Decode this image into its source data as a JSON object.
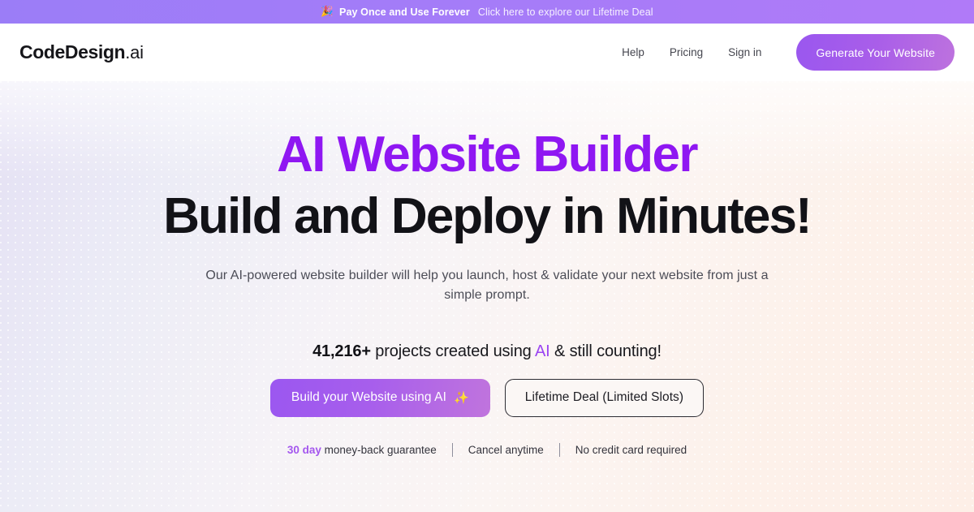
{
  "promo": {
    "emoji": "🎉",
    "icon_name": "party-popper-icon",
    "bold_text": "Pay Once and Use Forever",
    "link_text": "Click here to explore our Lifetime Deal",
    "bg_color_left": "#9b7df7",
    "bg_color_right": "#b07af8"
  },
  "header": {
    "logo_main": "CodeDesign",
    "logo_suffix": ".ai",
    "nav": [
      {
        "label": "Help"
      },
      {
        "label": "Pricing"
      },
      {
        "label": "Sign in"
      }
    ],
    "cta_label": "Generate Your Website",
    "cta_gradient_from": "#9a57ef",
    "cta_gradient_to": "#bd72de"
  },
  "hero": {
    "title_line1": "AI Website Builder",
    "title_line2": "Build and Deploy in Minutes!",
    "title_line1_color": "#8f17f2",
    "title_line2_color": "#121217",
    "subtitle": "Our AI-powered website builder will help you launch, host & validate your next website from just a simple prompt.",
    "stats": {
      "count": "41,216+",
      "text_before_ai": " projects created using ",
      "ai_word": "AI",
      "text_after_ai": " & still counting!",
      "ai_color": "#9b45f2"
    },
    "primary_button": {
      "label": "Build your Website using AI",
      "emoji": "✨",
      "icon_name": "sparkles-icon"
    },
    "secondary_button": {
      "label": "Lifetime Deal (Limited Slots)"
    },
    "trust": {
      "item1_accent": "30 day",
      "item1_rest": " money-back guarantee",
      "item2": "Cancel anytime",
      "item3": "No credit card required",
      "accent_color": "#a457ee"
    },
    "bg_gradient_from": "#e4e0f4",
    "bg_gradient_to": "#fdefe7"
  }
}
